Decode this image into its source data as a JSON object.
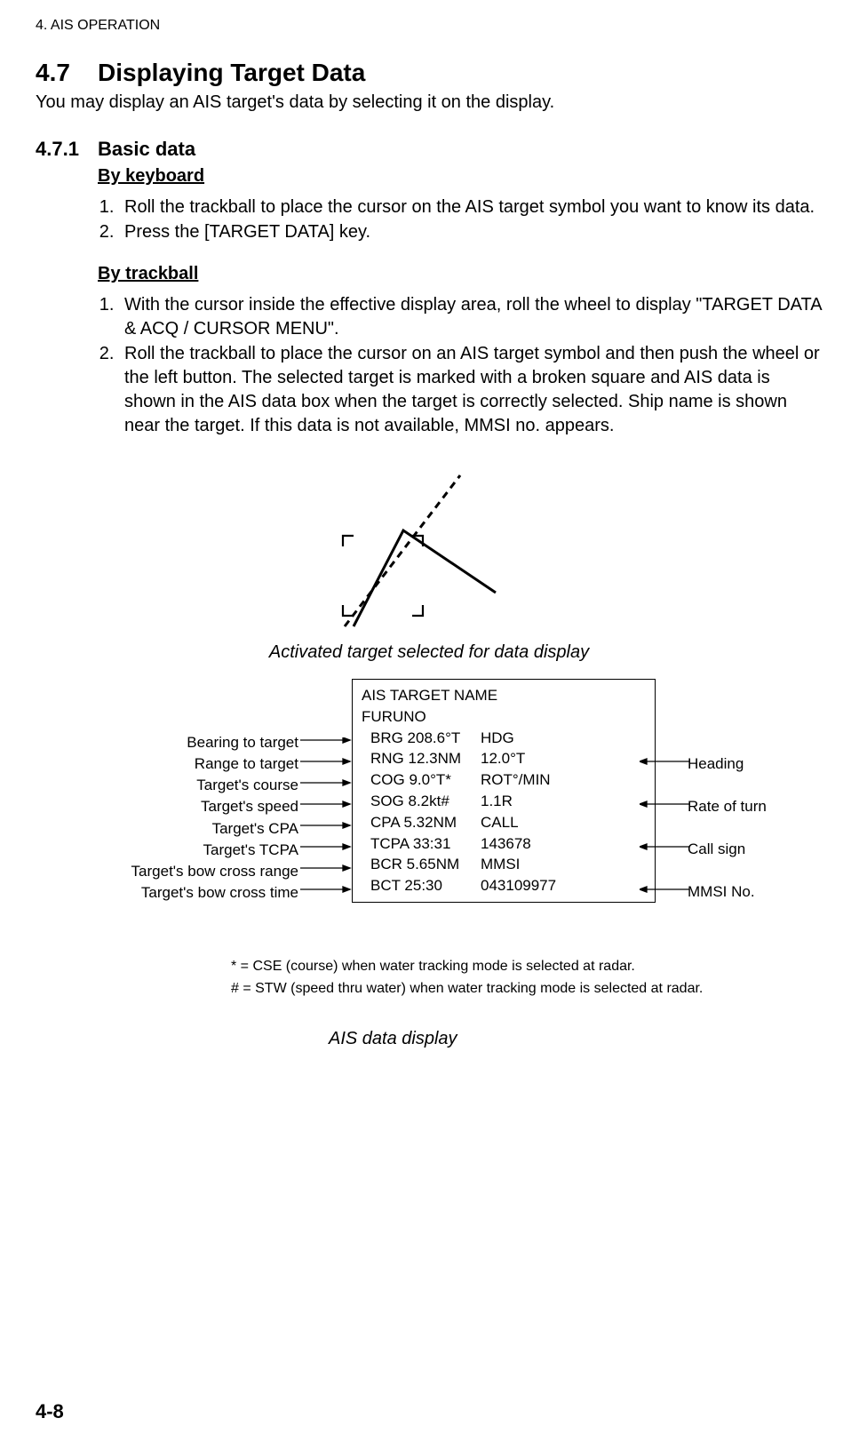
{
  "header": "4. AIS OPERATION",
  "section": {
    "num": "4.7",
    "title": "Displaying Target Data"
  },
  "intro": "You may display an AIS target's data by selecting it on the display.",
  "subsection": {
    "num": "4.7.1",
    "title": "Basic data"
  },
  "kb_heading": "By keyboard",
  "kb_steps": [
    "Roll the trackball to place the cursor on the AIS target symbol you want to know its data.",
    "Press the [TARGET DATA] key."
  ],
  "tb_heading": "By trackball",
  "tb_steps": [
    "With the cursor inside the effective display area, roll the wheel to display \"TARGET DATA & ACQ / CURSOR MENU\".",
    "Roll the trackball to place the cursor on an AIS target symbol and then push the wheel or the left button. The selected target is marked with a broken square and AIS data is shown in the AIS data box when the target is correctly selected. Ship name is shown near the target. If this data is not available, MMSI no. appears."
  ],
  "fig1_caption": "Activated target selected for data display",
  "databox": {
    "title": "AIS TARGET NAME",
    "name": "FURUNO",
    "rows": [
      {
        "l": "BRG  208.6°T",
        "r": "HDG"
      },
      {
        "l": "RNG 12.3NM",
        "r": "12.0°T"
      },
      {
        "l": "COG  9.0°T*",
        "r": "ROT°/MIN"
      },
      {
        "l": "SOG 8.2kt#",
        "r": "1.1R"
      },
      {
        "l": "CPA 5.32NM",
        "r": "CALL"
      },
      {
        "l": "TCPA 33:31",
        "r": "143678"
      },
      {
        "l": "BCR 5.65NM",
        "r": "MMSI"
      },
      {
        "l": "BCT  25:30",
        "r": "043109977"
      }
    ]
  },
  "left_labels": [
    "Bearing to target",
    "Range to target",
    "Target's course",
    "Target's speed",
    "Target's CPA",
    "Target's TCPA",
    "Target's bow cross range",
    "Target's bow cross time"
  ],
  "right_labels": {
    "heading": "Heading",
    "rot": "Rate of turn",
    "call": "Call sign",
    "mmsi": "MMSI No."
  },
  "footnote1": "* = CSE (course) when water tracking mode is selected at radar.",
  "footnote2": "# = STW (speed thru water) when water tracking mode is selected at radar.",
  "fig2_caption": "AIS data display",
  "page_num": "4-8"
}
